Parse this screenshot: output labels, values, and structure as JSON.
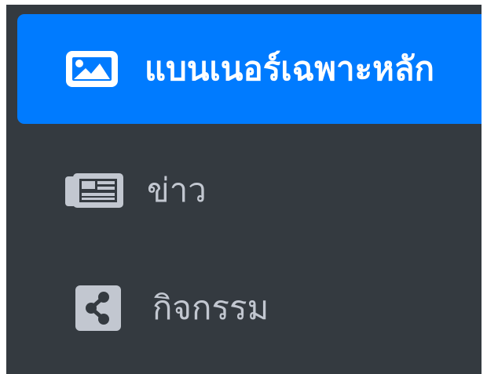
{
  "sidebar": {
    "items": [
      {
        "label": "แบนเนอร์เฉพาะหลัก",
        "icon": "image-icon",
        "active": true
      },
      {
        "label": "ข่าว",
        "icon": "newspaper-icon",
        "active": false
      },
      {
        "label": "กิจกรรม",
        "icon": "share-square-icon",
        "active": false
      }
    ]
  },
  "colors": {
    "sidebar_bg": "#343a40",
    "active_bg": "#007bff",
    "active_text": "#ffffff",
    "inactive_text": "#c2c7d0"
  }
}
